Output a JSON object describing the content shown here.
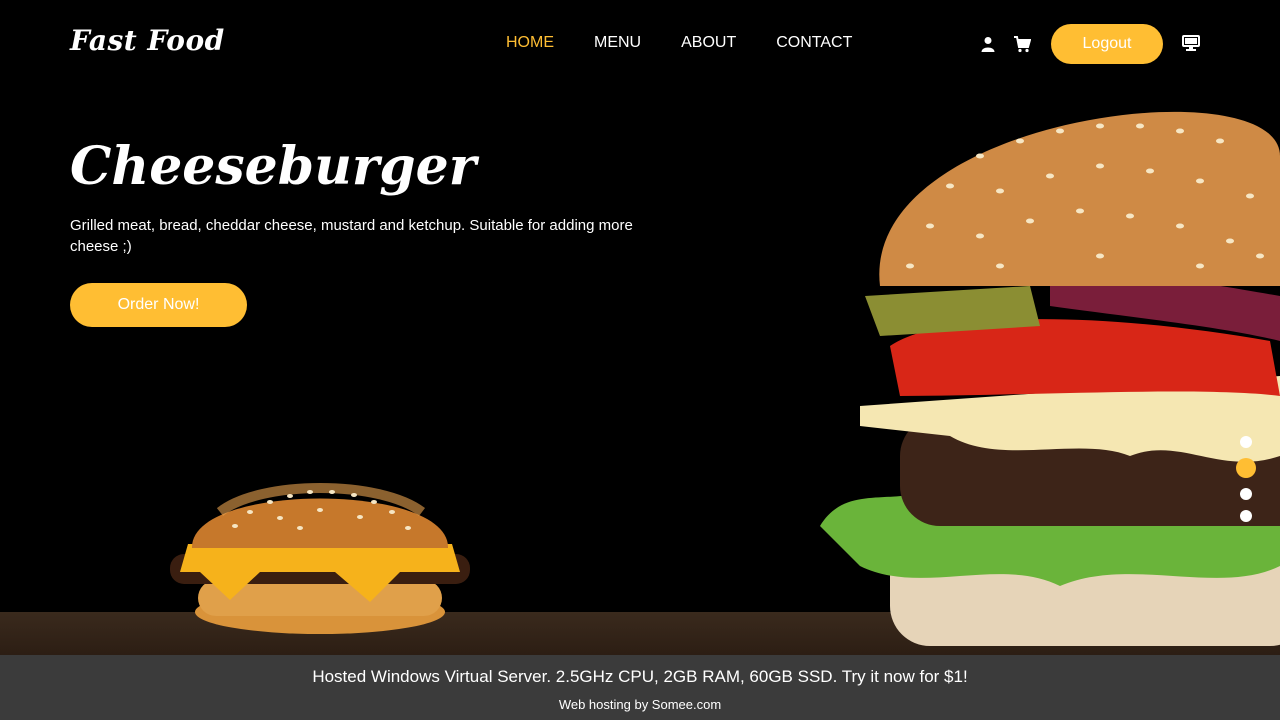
{
  "header": {
    "logo": "Fast Food",
    "nav": [
      {
        "label": "HOME",
        "active": true
      },
      {
        "label": "MENU",
        "active": false
      },
      {
        "label": "ABOUT",
        "active": false
      },
      {
        "label": "CONTACT",
        "active": false
      }
    ],
    "icons": [
      "user-icon",
      "cart-icon",
      "monitor-icon"
    ],
    "logout_label": "Logout"
  },
  "hero": {
    "title": "Cheeseburger",
    "description": "Grilled meat, bread, cheddar cheese, mustard and ketchup. Suitable for adding more cheese ;)",
    "order_label": "Order Now!"
  },
  "carousel": {
    "slide_count": 4,
    "active_index": 1
  },
  "footer": {
    "promo": "Hosted Windows Virtual Server. 2.5GHz CPU, 2GB RAM, 60GB SSD. Try it now for $1!",
    "hosting": "Web hosting by Somee.com"
  },
  "colors": {
    "accent": "#ffbe33",
    "background": "#000000",
    "footer_bg": "#3b3b3b"
  }
}
